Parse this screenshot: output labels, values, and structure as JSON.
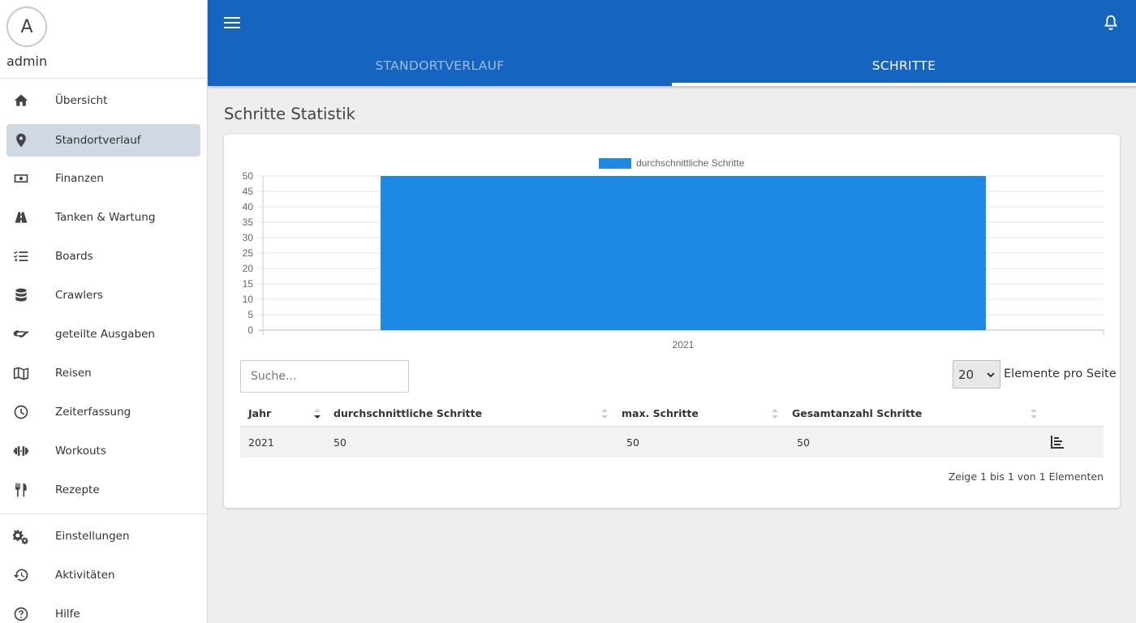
{
  "user": {
    "avatar_letter": "A",
    "name": "admin"
  },
  "sidebar": {
    "items": [
      {
        "label": "Übersicht",
        "icon": "home-icon"
      },
      {
        "label": "Standortverlauf",
        "icon": "map-marker-icon",
        "active": true
      },
      {
        "label": "Finanzen",
        "icon": "money-bill-icon"
      },
      {
        "label": "Tanken & Wartung",
        "icon": "road-icon"
      },
      {
        "label": "Boards",
        "icon": "tasks-icon"
      },
      {
        "label": "Crawlers",
        "icon": "database-icon"
      },
      {
        "label": "geteilte Ausgaben",
        "icon": "handshake-icon"
      },
      {
        "label": "Reisen",
        "icon": "map-icon"
      },
      {
        "label": "Zeiterfassung",
        "icon": "clock-icon"
      },
      {
        "label": "Workouts",
        "icon": "dumbbell-icon"
      },
      {
        "label": "Rezepte",
        "icon": "utensils-icon"
      }
    ],
    "bottom_items": [
      {
        "label": "Einstellungen",
        "icon": "cogs-icon"
      },
      {
        "label": "Aktivitäten",
        "icon": "history-icon"
      },
      {
        "label": "Hilfe",
        "icon": "question-circle-icon"
      }
    ]
  },
  "header": {
    "tabs": [
      {
        "label": "STANDORTVERLAUF"
      },
      {
        "label": "SCHRITTE",
        "active": true
      }
    ],
    "accent": "#1565c0"
  },
  "main": {
    "title": "Schritte Statistik",
    "search_placeholder": "Suche...",
    "page_size": "20",
    "page_size_label": "Elemente pro Seite",
    "table": {
      "columns": [
        "Jahr",
        "durchschnittliche Schritte",
        "max. Schritte",
        "Gesamtanzahl Schritte"
      ],
      "rows": [
        {
          "jahr": "2021",
          "avg": "50",
          "max": "50",
          "total": "50"
        }
      ]
    },
    "info": "Zeige 1 bis 1 von 1 Elementen"
  },
  "chart_data": {
    "type": "bar",
    "categories": [
      "2021"
    ],
    "series": [
      {
        "name": "durchschnittliche Schritte",
        "values": [
          50
        ],
        "color": "#1e88e5"
      }
    ],
    "ylim": [
      0,
      50
    ],
    "yticks": [
      0,
      5,
      10,
      15,
      20,
      25,
      30,
      35,
      40,
      45,
      50
    ],
    "legend": "top",
    "grid": true
  }
}
